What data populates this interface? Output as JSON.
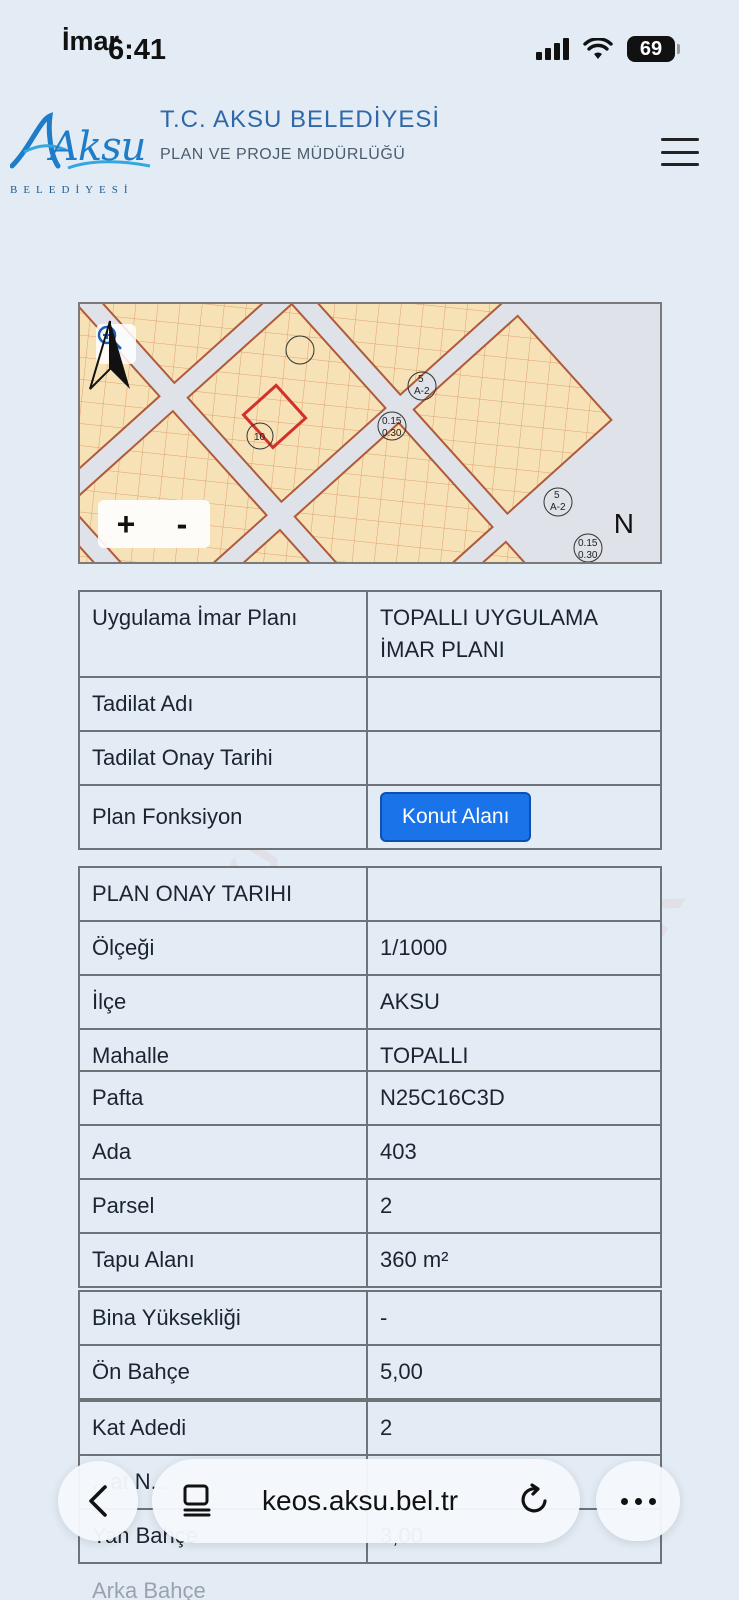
{
  "status": {
    "app": "İmar",
    "time": "6:41",
    "battery": "69"
  },
  "header": {
    "logo_text": "Aksu",
    "logo_sub": "BELEDİYESİ",
    "title": "T.C. AKSU BELEDİYESİ",
    "subtitle": "PLAN VE PROJE MÜDÜRLÜĞÜ"
  },
  "map": {
    "zoom_in": "+",
    "zoom_out": "-",
    "north": "N",
    "labels": [
      "10",
      "0.15",
      "0.30",
      "5",
      "A-2",
      "0.15",
      "0.30",
      "5",
      "A-2"
    ]
  },
  "table1": {
    "rows": [
      {
        "key": "Uygulama İmar Planı",
        "value": "TOPALLI UYGULAMA İMAR PLANI"
      },
      {
        "key": "Tadilat Adı",
        "value": ""
      },
      {
        "key": "Tadilat Onay Tarihi",
        "value": ""
      },
      {
        "key": "Plan Fonksiyon",
        "button": "Konut Alanı"
      }
    ]
  },
  "table2": {
    "rows": [
      {
        "key": "PLAN ONAY TARIHI",
        "value": ""
      },
      {
        "key": "Ölçeği",
        "value": "1/1000"
      },
      {
        "key": "İlçe",
        "value": "AKSU"
      },
      {
        "key": "Mahalle",
        "value": "TOPALLI"
      }
    ]
  },
  "table3": {
    "rows": [
      {
        "key": "Pafta",
        "value": "N25C16C3D"
      },
      {
        "key": "Ada",
        "value": "403"
      },
      {
        "key": "Parsel",
        "value": "2"
      },
      {
        "key": "Tapu Alanı",
        "value": "360 m²"
      }
    ]
  },
  "table4": {
    "rows": [
      {
        "key": "Bina Yüksekliği",
        "value": "-"
      },
      {
        "key": "Ön Bahçe",
        "value": "5,00"
      }
    ]
  },
  "table5": {
    "rows": [
      {
        "key": "Kat Adedi",
        "value": "2"
      },
      {
        "key": "...at N...",
        "value": ""
      },
      {
        "key": "Yan Bahçe",
        "value": "3,00"
      },
      {
        "key": "Arka Bahçe",
        "value": ""
      }
    ]
  },
  "watermark": "ÖRNEKTİR",
  "watermark2": "emlakjet.com",
  "browser": {
    "url": "keos.aksu.bel.tr"
  },
  "colors": {
    "accent": "#1a73e8",
    "brand": "#2f67a7",
    "parcel": "#f6e2b6",
    "park": "#2f9a2c"
  }
}
